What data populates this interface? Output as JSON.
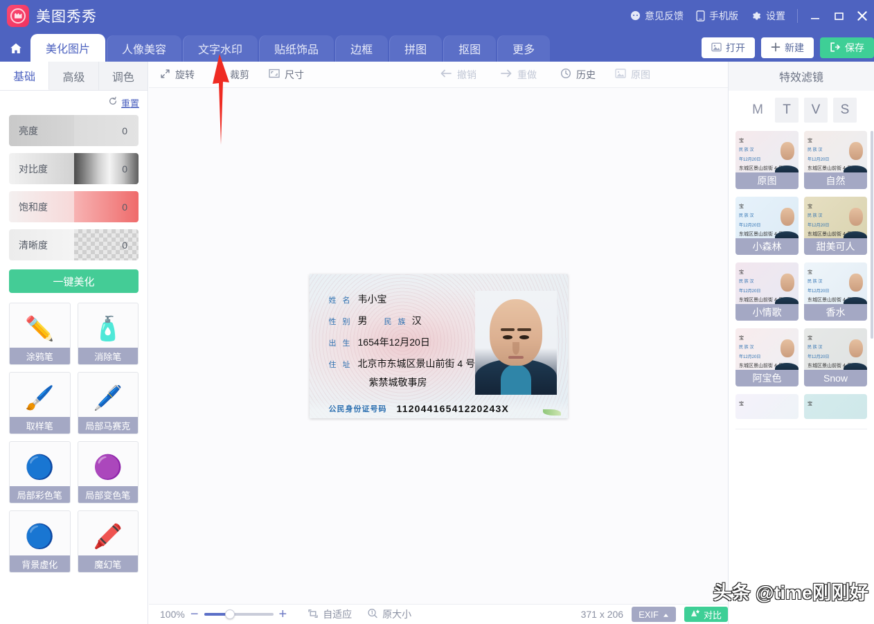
{
  "titlebar": {
    "app_name": "美图秀秀",
    "logo_icon": "meitu-logo-icon",
    "feedback": "意见反馈",
    "mobile": "手机版",
    "settings": "设置",
    "minimize": "minimize-icon",
    "maximize": "maximize-icon",
    "close": "close-icon",
    "bg_color": "#4e63c0"
  },
  "tabs": {
    "home_icon": "home-icon",
    "items": [
      {
        "label": "美化图片",
        "active": true
      },
      {
        "label": "人像美容",
        "active": false
      },
      {
        "label": "文字水印",
        "active": false
      },
      {
        "label": "贴纸饰品",
        "active": false
      },
      {
        "label": "边框",
        "active": false
      },
      {
        "label": "拼图",
        "active": false
      },
      {
        "label": "抠图",
        "active": false
      },
      {
        "label": "更多",
        "active": false
      }
    ],
    "actions": [
      {
        "label": "打开",
        "icon": "image-open-icon",
        "style": "white"
      },
      {
        "label": "新建",
        "icon": "plus-icon",
        "style": "white"
      },
      {
        "label": "保存",
        "icon": "save-export-icon",
        "style": "green"
      }
    ]
  },
  "left_panel": {
    "tabs": [
      {
        "label": "基础",
        "active": true
      },
      {
        "label": "高级",
        "active": false
      },
      {
        "label": "调色",
        "active": false
      }
    ],
    "reset": {
      "label": "重置",
      "icon": "reset-circular-arrow-icon"
    },
    "sliders": [
      {
        "name": "亮度",
        "value": "0"
      },
      {
        "name": "对比度",
        "value": "0"
      },
      {
        "name": "饱和度",
        "value": "0"
      },
      {
        "name": "清晰度",
        "value": "0"
      }
    ],
    "beautify_button": "一键美化",
    "tools": [
      {
        "label": "涂鸦笔",
        "icon": "✏️"
      },
      {
        "label": "消除笔",
        "icon": "🧴"
      },
      {
        "label": "取样笔",
        "icon": "🖌️"
      },
      {
        "label": "局部马赛克",
        "icon": "🖊️"
      },
      {
        "label": "局部彩色笔",
        "icon": "🔵"
      },
      {
        "label": "局部变色笔",
        "icon": "🟣"
      },
      {
        "label": "背景虚化",
        "icon": "🔵"
      },
      {
        "label": "魔幻笔",
        "icon": "🖍️"
      }
    ]
  },
  "canvas_toolbar": {
    "left_items": [
      {
        "label": "旋转",
        "icon": "rotate-resize-icon"
      },
      {
        "label": "裁剪",
        "icon": "scissors-crop-icon"
      },
      {
        "label": "尺寸",
        "icon": "frame-size-icon"
      }
    ],
    "right_items": [
      {
        "label": "撤销",
        "icon": "undo-arrow-icon"
      },
      {
        "label": "重做",
        "icon": "redo-arrow-icon"
      },
      {
        "label": "历史",
        "icon": "clock-history-icon"
      },
      {
        "label": "原图",
        "icon": "original-image-icon"
      }
    ]
  },
  "id_card": {
    "name_label": "姓 名",
    "name_value": "韦小宝",
    "sex_label": "性 别",
    "sex_value": "男",
    "nation_label": "民 族",
    "nation_value": "汉",
    "birth_label": "出 生",
    "birth_year": "1654",
    "birth_year_unit": "年",
    "birth_month": "12",
    "birth_month_unit": "月",
    "birth_day": "20",
    "birth_day_unit": "日",
    "address_label": "住 址",
    "address_line1": "北京市东城区景山前街 4 号",
    "address_line2": "紫禁城敬事房",
    "id_number_label": "公民身份证号码",
    "id_number": "11204416541220243X"
  },
  "status_bar": {
    "zoom": "100%",
    "minus_icon": "zoom-out-icon",
    "plus_icon": "zoom-in-icon",
    "fit": {
      "label": "自适应",
      "icon": "fit-screen-icon"
    },
    "actual": {
      "label": "原大小",
      "icon": "actual-size-icon"
    },
    "dimensions": "371 x 206",
    "exif": {
      "label": "EXIF",
      "icon": "caret-up-icon"
    },
    "compare": {
      "label": "对比",
      "icon": "compare-star-icon"
    }
  },
  "right_panel": {
    "title": "特效滤镜",
    "letters": [
      {
        "label": "M",
        "selected": true
      },
      {
        "label": "T",
        "selected": false
      },
      {
        "label": "V",
        "selected": false
      },
      {
        "label": "S",
        "selected": false
      }
    ],
    "filters": [
      {
        "label": "原图",
        "tint": "rgba(247,236,238,0.55)"
      },
      {
        "label": "自然",
        "tint": "rgba(240,236,232,0.35)"
      },
      {
        "label": "小森林",
        "tint": "rgba(214,236,247,0.50)"
      },
      {
        "label": "甜美可人",
        "tint": "rgba(222,214,176,0.45)"
      },
      {
        "label": "小情歌",
        "tint": "rgba(236,224,232,0.45)"
      },
      {
        "label": "香水",
        "tint": "rgba(228,238,246,0.45)"
      },
      {
        "label": "阿宝色",
        "tint": "rgba(247,232,234,0.45)"
      },
      {
        "label": "Snow",
        "tint": "rgba(226,228,226,0.50)"
      },
      {
        "label": "",
        "tint": "rgba(242,240,248,0.45)"
      },
      {
        "label": "",
        "tint": "rgba(206,232,234,0.55)"
      }
    ]
  },
  "watermark": "头条 @time刚刚好"
}
